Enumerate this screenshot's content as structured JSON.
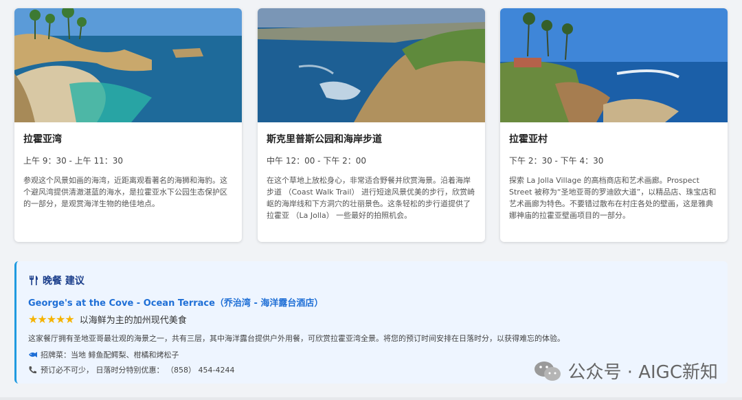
{
  "cards": [
    {
      "title": "拉霍亚湾",
      "time": "上午 9：30 - 上午 11：30",
      "desc": "参观这个风景如画的海湾，近距离观看著名的海狮和海豹。这个避风湾提供清澈湛蓝的海水，是拉霍亚水下公园生态保护区的一部分，是观赏海洋生物的绝佳地点。"
    },
    {
      "title": "斯克里普斯公园和海岸步道",
      "time": "中午 12：00 - 下午 2：00",
      "desc": "在这个草地上放松身心，非常适合野餐并欣赏海景。沿着海岸步道 （Coast Walk Trail） 进行短途风景优美的步行，欣赏崎岖的海岸线和下方洞穴的壮丽景色。这条轻松的步行道提供了拉霍亚 （La Jolla） 一些最好的拍照机会。"
    },
    {
      "title": "拉霍亚村",
      "time": "下午 2：30 - 下午 4：30",
      "desc": "探索 La Jolla Village 的高档商店和艺术画廊。Prospect Street 被称为“圣地亚哥的罗迪欧大道”，以精品店、珠宝店和艺术画廊为特色。不要错过散布在村庄各处的壁画，这是雅典娜神庙的拉霍亚壁画项目的一部分。"
    }
  ],
  "dinner": {
    "title": "晚餐 建议",
    "restaurant": "George's at the Cove - Ocean Terrace（乔治湾 - 海洋露台酒店）",
    "stars": "★★★★★",
    "rating": 5,
    "cuisine": "以海鲜为主的加州现代美食",
    "desc": "这家餐厅拥有圣地亚哥最壮观的海景之一，共有三层，其中海洋露台提供户外用餐，可欣赏拉霍亚湾全景。将您的预订时间安排在日落时分，以获得难忘的体验。",
    "signature": "招牌菜：当地 鲱鱼配鳄梨、柑橘和烤松子",
    "reservation": "预订必不可少， 日落时分特别优惠： （858） 454-4244"
  },
  "watermark": "公众号 · AIGC新知",
  "colors": {
    "accent": "#1f6fd6",
    "star": "#f5b301",
    "panel": "#eef5ff"
  }
}
